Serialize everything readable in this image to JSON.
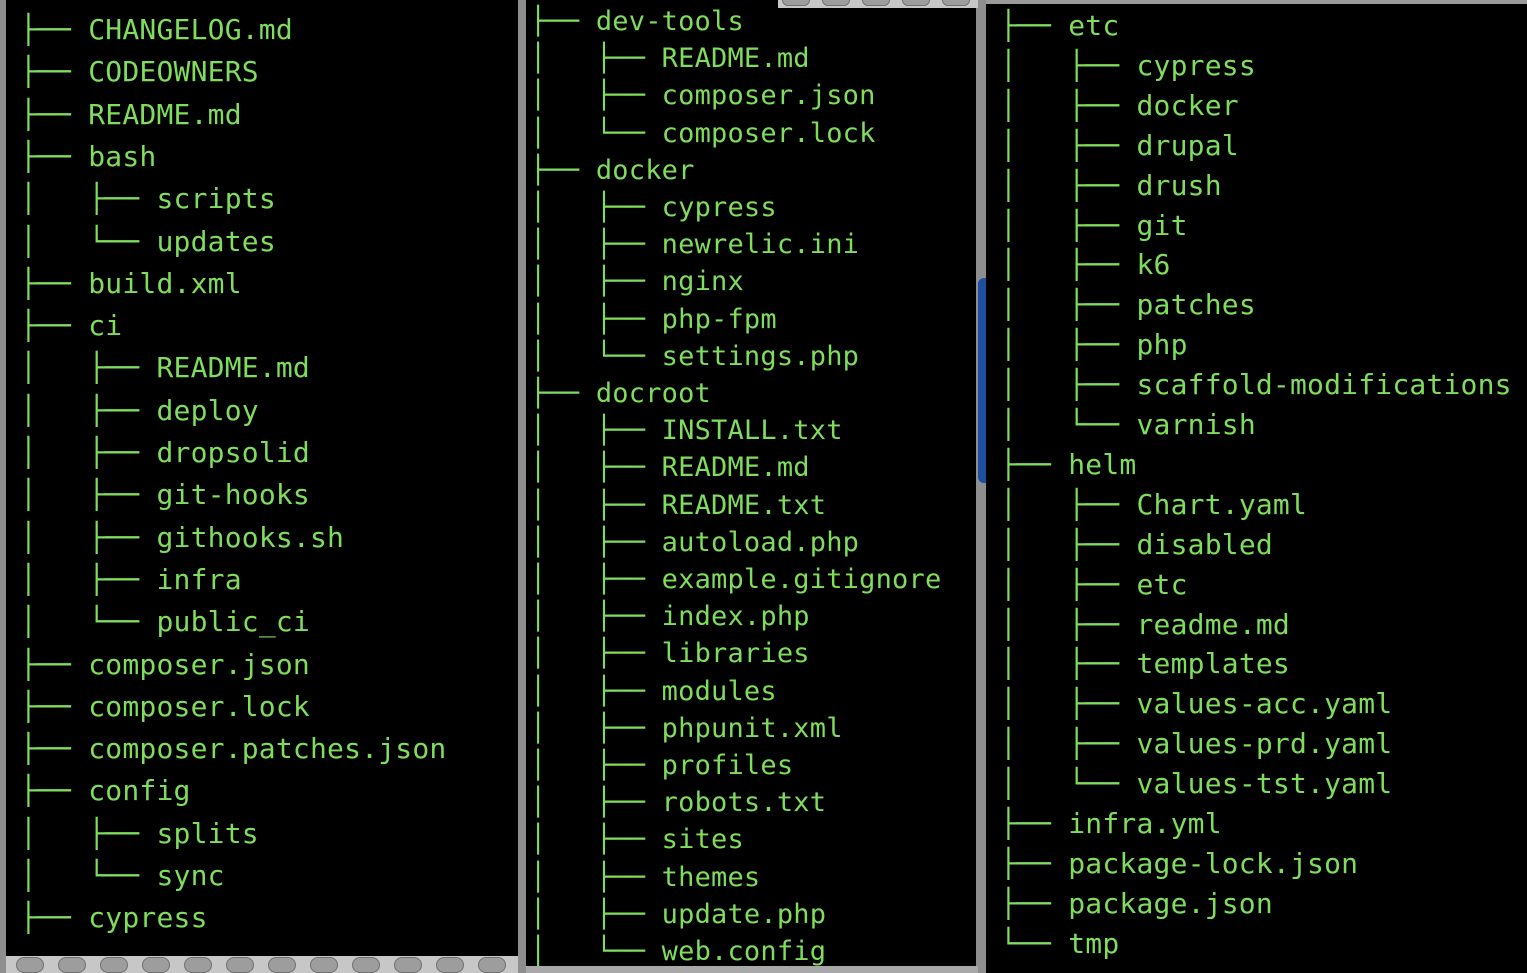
{
  "panels": [
    {
      "lines": [
        {
          "prefix": "├── ",
          "name": "CHANGELOG.md"
        },
        {
          "prefix": "├── ",
          "name": "CODEOWNERS"
        },
        {
          "prefix": "├── ",
          "name": "README.md"
        },
        {
          "prefix": "├── ",
          "name": "bash"
        },
        {
          "prefix": "│   ├── ",
          "name": "scripts"
        },
        {
          "prefix": "│   └── ",
          "name": "updates"
        },
        {
          "prefix": "├── ",
          "name": "build.xml"
        },
        {
          "prefix": "├── ",
          "name": "ci"
        },
        {
          "prefix": "│   ├── ",
          "name": "README.md"
        },
        {
          "prefix": "│   ├── ",
          "name": "deploy"
        },
        {
          "prefix": "│   ├── ",
          "name": "dropsolid"
        },
        {
          "prefix": "│   ├── ",
          "name": "git-hooks"
        },
        {
          "prefix": "│   ├── ",
          "name": "githooks.sh"
        },
        {
          "prefix": "│   ├── ",
          "name": "infra"
        },
        {
          "prefix": "│   └── ",
          "name": "public_ci"
        },
        {
          "prefix": "├── ",
          "name": "composer.json"
        },
        {
          "prefix": "├── ",
          "name": "composer.lock"
        },
        {
          "prefix": "├── ",
          "name": "composer.patches.json"
        },
        {
          "prefix": "├── ",
          "name": "config"
        },
        {
          "prefix": "│   ├── ",
          "name": "splits"
        },
        {
          "prefix": "│   └── ",
          "name": "sync"
        },
        {
          "prefix": "├── ",
          "name": "cypress"
        }
      ]
    },
    {
      "lines": [
        {
          "prefix": "├── ",
          "name": "dev-tools"
        },
        {
          "prefix": "│   ├── ",
          "name": "README.md"
        },
        {
          "prefix": "│   ├── ",
          "name": "composer.json"
        },
        {
          "prefix": "│   └── ",
          "name": "composer.lock"
        },
        {
          "prefix": "├── ",
          "name": "docker"
        },
        {
          "prefix": "│   ├── ",
          "name": "cypress"
        },
        {
          "prefix": "│   ├── ",
          "name": "newrelic.ini"
        },
        {
          "prefix": "│   ├── ",
          "name": "nginx"
        },
        {
          "prefix": "│   ├── ",
          "name": "php-fpm"
        },
        {
          "prefix": "│   └── ",
          "name": "settings.php"
        },
        {
          "prefix": "├── ",
          "name": "docroot"
        },
        {
          "prefix": "│   ├── ",
          "name": "INSTALL.txt"
        },
        {
          "prefix": "│   ├── ",
          "name": "README.md"
        },
        {
          "prefix": "│   ├── ",
          "name": "README.txt"
        },
        {
          "prefix": "│   ├── ",
          "name": "autoload.php"
        },
        {
          "prefix": "│   ├── ",
          "name": "example.gitignore"
        },
        {
          "prefix": "│   ├── ",
          "name": "index.php"
        },
        {
          "prefix": "│   ├── ",
          "name": "libraries"
        },
        {
          "prefix": "│   ├── ",
          "name": "modules"
        },
        {
          "prefix": "│   ├── ",
          "name": "phpunit.xml"
        },
        {
          "prefix": "│   ├── ",
          "name": "profiles"
        },
        {
          "prefix": "│   ├── ",
          "name": "robots.txt"
        },
        {
          "prefix": "│   ├── ",
          "name": "sites"
        },
        {
          "prefix": "│   ├── ",
          "name": "themes"
        },
        {
          "prefix": "│   ├── ",
          "name": "update.php"
        },
        {
          "prefix": "│   └── ",
          "name": "web.config"
        }
      ]
    },
    {
      "lines": [
        {
          "prefix": "├── ",
          "name": "etc"
        },
        {
          "prefix": "│   ├── ",
          "name": "cypress"
        },
        {
          "prefix": "│   ├── ",
          "name": "docker"
        },
        {
          "prefix": "│   ├── ",
          "name": "drupal"
        },
        {
          "prefix": "│   ├── ",
          "name": "drush"
        },
        {
          "prefix": "│   ├── ",
          "name": "git"
        },
        {
          "prefix": "│   ├── ",
          "name": "k6"
        },
        {
          "prefix": "│   ├── ",
          "name": "patches"
        },
        {
          "prefix": "│   ├── ",
          "name": "php"
        },
        {
          "prefix": "│   ├── ",
          "name": "scaffold-modifications"
        },
        {
          "prefix": "│   └── ",
          "name": "varnish"
        },
        {
          "prefix": "├── ",
          "name": "helm"
        },
        {
          "prefix": "│   ├── ",
          "name": "Chart.yaml"
        },
        {
          "prefix": "│   ├── ",
          "name": "disabled"
        },
        {
          "prefix": "│   ├── ",
          "name": "etc"
        },
        {
          "prefix": "│   ├── ",
          "name": "readme.md"
        },
        {
          "prefix": "│   ├── ",
          "name": "templates"
        },
        {
          "prefix": "│   ├── ",
          "name": "values-acc.yaml"
        },
        {
          "prefix": "│   ├── ",
          "name": "values-prd.yaml"
        },
        {
          "prefix": "│   └── ",
          "name": "values-tst.yaml"
        },
        {
          "prefix": "├── ",
          "name": "infra.yml"
        },
        {
          "prefix": "├── ",
          "name": "package-lock.json"
        },
        {
          "prefix": "├── ",
          "name": "package.json"
        },
        {
          "prefix": "└── ",
          "name": "tmp"
        }
      ]
    }
  ],
  "colors": {
    "background": "#000000",
    "text": "#7fdc5c"
  }
}
